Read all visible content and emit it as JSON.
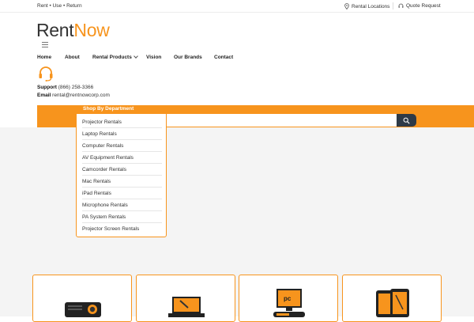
{
  "topbar": {
    "tagline": "Rent • Use • Return",
    "locations": "Rental Locations",
    "quote": "Quote Request"
  },
  "logo": {
    "part1": "Rent",
    "part2": "Now"
  },
  "nav": [
    "Home",
    "About",
    "Rental Products",
    "Vision",
    "Our Brands",
    "Contact"
  ],
  "support": {
    "support_label": "Support",
    "phone": "(866) 258-3366",
    "email_label": "Email",
    "email": "rental@rentnowcorp.com"
  },
  "dept_header": "Shop By Department",
  "departments": [
    "Projector Rentals",
    "Laptop Rentals",
    "Computer Rentals",
    "AV Equipment Rentals",
    "Camcorder Rentals",
    "Mac Rentals",
    "iPad Rentals",
    "Microphone Rentals",
    "PA System Rentals",
    "Projector Screen Rentals"
  ],
  "colors": {
    "accent": "#f7941d",
    "dark": "#2e3a47"
  },
  "icons": [
    "map-pin-icon",
    "headset-icon",
    "search-icon",
    "projector-icon",
    "laptop-icon",
    "computer-icon",
    "tablet-icon"
  ]
}
